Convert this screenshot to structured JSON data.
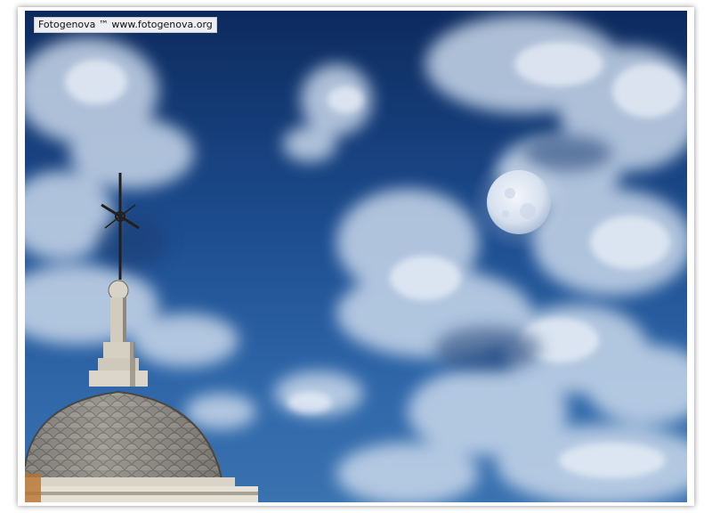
{
  "watermark": {
    "text": "Fotogenova ™  www.fotogenova.org"
  },
  "colors": {
    "sky_top": "#0d2a5e",
    "sky_bottom": "#3a72b0",
    "cloud": "#dfe8f4",
    "moon": "#e8eef8",
    "dome": "#8f8d86"
  }
}
